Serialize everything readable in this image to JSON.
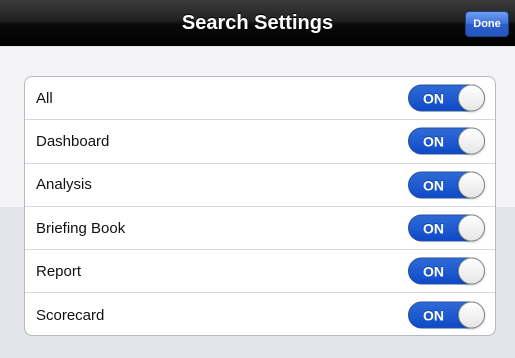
{
  "navbar": {
    "title": "Search Settings",
    "done_label": "Done"
  },
  "settings": {
    "items": [
      {
        "label": "All",
        "toggle_label": "ON",
        "enabled": true
      },
      {
        "label": "Dashboard",
        "toggle_label": "ON",
        "enabled": true
      },
      {
        "label": "Analysis",
        "toggle_label": "ON",
        "enabled": true
      },
      {
        "label": "Briefing Book",
        "toggle_label": "ON",
        "enabled": true
      },
      {
        "label": "Report",
        "toggle_label": "ON",
        "enabled": true
      },
      {
        "label": "Scorecard",
        "toggle_label": "ON",
        "enabled": true
      }
    ]
  },
  "colors": {
    "toggle_on": "#1f5bd0",
    "done_button": "#3a6fd8",
    "navbar": "#000000"
  }
}
